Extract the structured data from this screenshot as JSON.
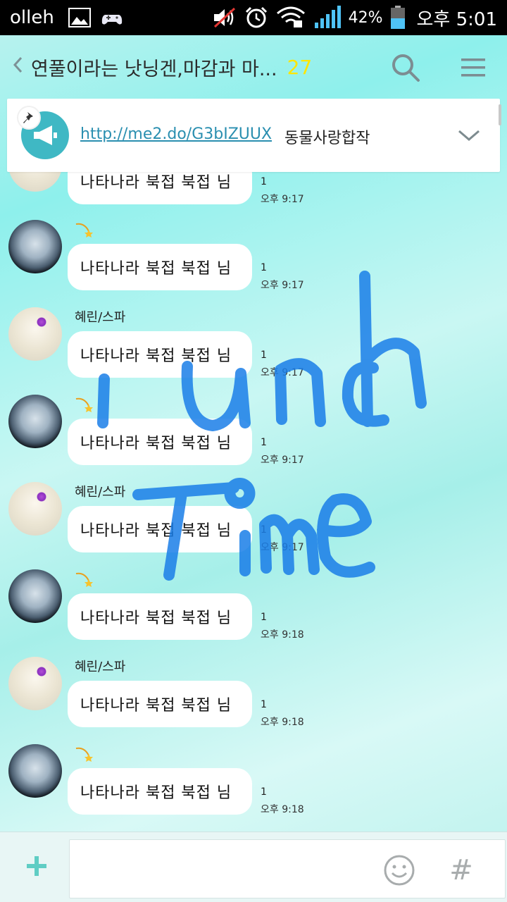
{
  "status_bar": {
    "carrier": "olleh",
    "battery_percent": "42%",
    "time": "오후 5:01"
  },
  "header": {
    "back_icon": "chevron-left-icon",
    "title": "연풀이라는 낫닝겐,마감과 마...",
    "member_count": "27",
    "search_icon": "search-icon",
    "menu_icon": "hamburger-menu-icon"
  },
  "notice": {
    "link": "http://me2.do/G3bIZUUX",
    "text": "동물사랑합작",
    "pin_icon": "pin-icon",
    "megaphone_icon": "megaphone-icon",
    "expand_icon": "chevron-down-icon"
  },
  "messages": [
    {
      "sender": "",
      "avatar": "girl-avatar",
      "text": "나타나라 북접 북접 님",
      "unread": "1",
      "time": "오후 9:17"
    },
    {
      "sender": "",
      "avatar": "moon-avatar",
      "sender_icon": "shooting-star-icon",
      "text": "나타나라 북접 북접 님",
      "unread": "1",
      "time": "오후 9:17"
    },
    {
      "sender": "혜린/스파",
      "avatar": "girl-avatar",
      "text": "나타나라 북접 북접 님",
      "unread": "1",
      "time": "오후 9:17"
    },
    {
      "sender": "",
      "avatar": "moon-avatar",
      "sender_icon": "shooting-star-icon",
      "text": "나타나라 북접 북접 님",
      "unread": "1",
      "time": "오후 9:17"
    },
    {
      "sender": "혜린/스파",
      "avatar": "girl-avatar",
      "text": "나타나라 북접 북접 님",
      "unread": "1",
      "time": "오후 9:17"
    },
    {
      "sender": "",
      "avatar": "moon-avatar",
      "sender_icon": "shooting-star-icon",
      "text": "나타나라 북접 북접 님",
      "unread": "1",
      "time": "오후 9:18"
    },
    {
      "sender": "혜린/스파",
      "avatar": "girl-avatar",
      "text": "나타나라 북접 북접 님",
      "unread": "1",
      "time": "오후 9:18"
    },
    {
      "sender": "",
      "avatar": "moon-avatar",
      "sender_icon": "shooting-star-icon",
      "text": "나타나라 북접 북접 님",
      "unread": "1",
      "time": "오후 9:18"
    }
  ],
  "scribble": {
    "line1": "Lunch",
    "line2": "Time",
    "color": "#1a7ee8"
  },
  "input_bar": {
    "plus_icon": "plus-icon",
    "placeholder": "",
    "emoji_icon": "emoji-icon",
    "hash_label": "#"
  }
}
